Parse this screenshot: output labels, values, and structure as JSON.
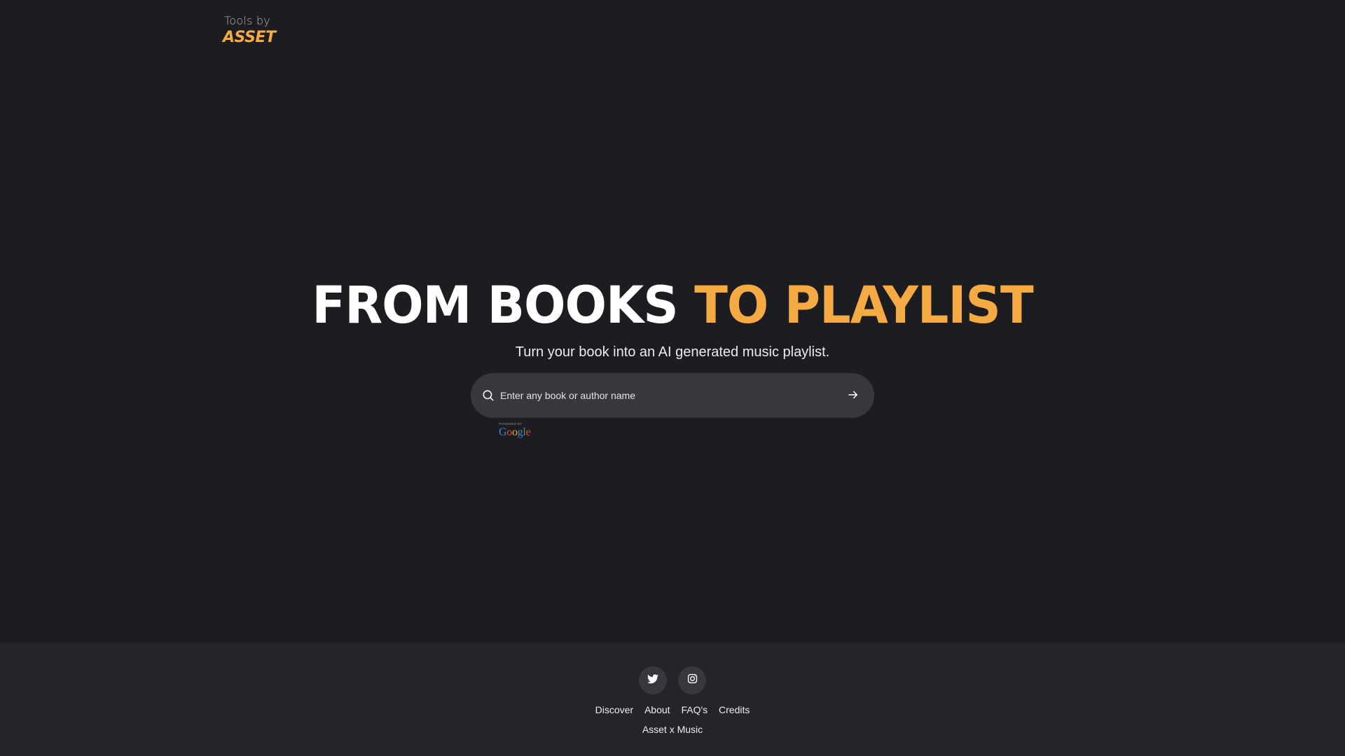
{
  "colors": {
    "background": "#1c1d21",
    "footer_background": "#242529",
    "accent": "#f6aa44",
    "input_background": "#37383e",
    "text": "#ffffff"
  },
  "logo": {
    "top": "Tools by",
    "brand": "ASSET"
  },
  "hero": {
    "title_white": "FROM BOOKS",
    "title_accent": "TO PLAYLIST",
    "subtitle": "Turn your book into an AI generated music playlist."
  },
  "search": {
    "placeholder": "Enter any book or author name",
    "value": "",
    "icon": "search-icon",
    "submit_icon": "arrow-right-icon"
  },
  "powered_by": {
    "label": "POWERED BY",
    "brand": "Google"
  },
  "footer": {
    "social": [
      {
        "icon": "twitter-icon",
        "label": "Twitter"
      },
      {
        "icon": "instagram-icon",
        "label": "Instagram"
      }
    ],
    "links": [
      "Discover",
      "About",
      "FAQ's",
      "Credits"
    ],
    "copyright": "Asset x Music"
  }
}
